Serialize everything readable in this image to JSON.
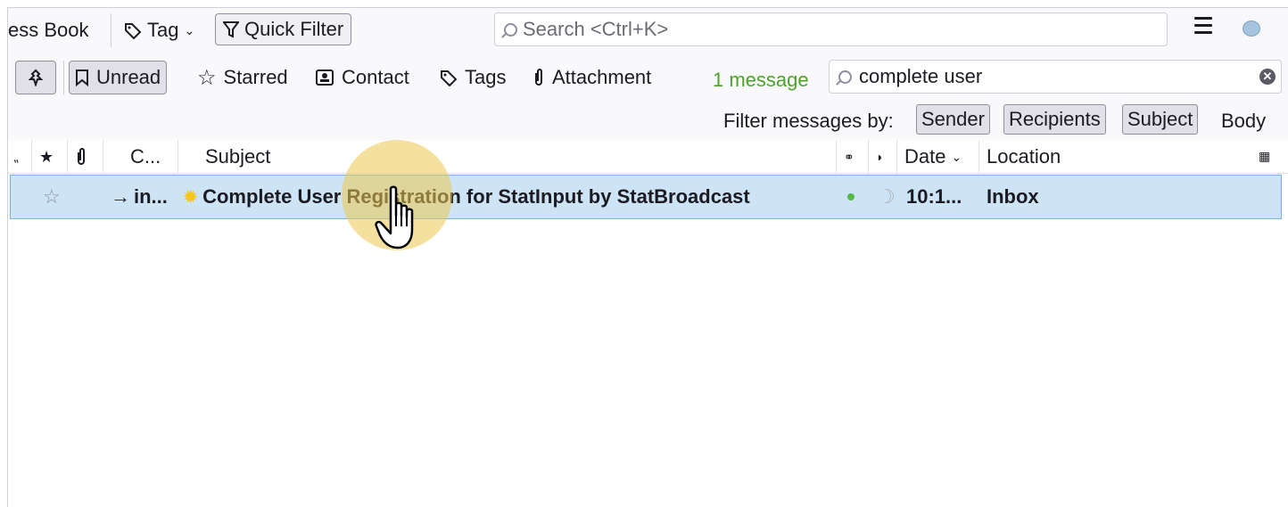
{
  "toolbar": {
    "address_book_label": "ess Book",
    "tag_label": "Tag",
    "quick_filter_label": "Quick Filter",
    "search_placeholder": "Search <Ctrl+K>"
  },
  "quick_filter": {
    "unread_label": "Unread",
    "starred_label": "Starred",
    "contact_label": "Contact",
    "tags_label": "Tags",
    "attachment_label": "Attachment",
    "message_count": "1 message",
    "search_value": "complete user",
    "filter_by_label": "Filter messages by:",
    "sender_label": "Sender",
    "recipients_label": "Recipients",
    "subject_label": "Subject",
    "body_label": "Body"
  },
  "columns": {
    "correspondent": "C...",
    "subject": "Subject",
    "date": "Date",
    "location": "Location"
  },
  "messages": [
    {
      "correspondent": "in...",
      "subject": "Complete User Registration for StatInput by StatBroadcast",
      "date": "10:1...",
      "location": "Inbox"
    }
  ],
  "colors": {
    "accent_selected_row": "#cde4f7",
    "unread_dot": "#54b948",
    "message_count_text": "#4ba32a"
  }
}
